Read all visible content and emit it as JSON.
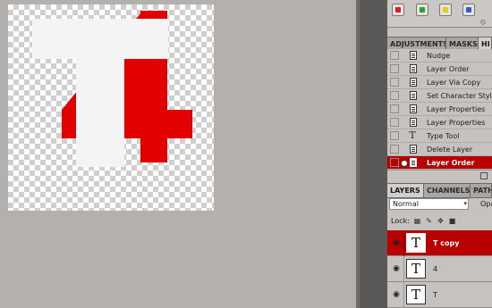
{
  "canvas": {
    "glyph_red": "4",
    "glyph_white": "T",
    "colors": {
      "red": "#e30000",
      "white": "#f4f4f4",
      "checker_light": "#ffffff",
      "checker_dark": "#cfcfcf"
    }
  },
  "swatches": [
    {
      "icon": "red-swatch-icon"
    },
    {
      "icon": "green-swatch-icon"
    },
    {
      "icon": "yellow-swatch-icon"
    },
    {
      "icon": "blue-swatch-icon"
    }
  ],
  "panel_tabs": {
    "top": [
      {
        "label": "ADJUSTMENTS",
        "active": false
      },
      {
        "label": "MASKS",
        "active": false
      },
      {
        "label": "HI",
        "active": true
      }
    ],
    "bottom": [
      {
        "label": "LAYERS",
        "active": true
      },
      {
        "label": "CHANNELS",
        "active": false
      },
      {
        "label": "PATH",
        "active": false
      }
    ]
  },
  "history": {
    "items": [
      {
        "label": "Nudge",
        "icon": "document-icon"
      },
      {
        "label": "Layer Order",
        "icon": "document-icon"
      },
      {
        "label": "Layer Via Copy",
        "icon": "document-icon"
      },
      {
        "label": "Set Character Style",
        "icon": "document-icon"
      },
      {
        "label": "Layer Properties",
        "icon": "document-icon"
      },
      {
        "label": "Layer Properties",
        "icon": "document-icon"
      },
      {
        "label": "Type Tool",
        "icon": "type-tool-icon",
        "glyph": "T"
      },
      {
        "label": "Delete Layer",
        "icon": "document-icon"
      },
      {
        "label": "Layer Order",
        "icon": "document-icon",
        "selected": true
      }
    ]
  },
  "layers": {
    "blend_mode": "Normal",
    "opacity_label": "Opa",
    "lock_label": "Lock:",
    "items": [
      {
        "name": "T copy",
        "thumb": "T",
        "selected": true
      },
      {
        "name": "4",
        "thumb": "T",
        "selected": false
      },
      {
        "name": "T",
        "thumb": "T",
        "selected": false
      }
    ]
  },
  "colors": {
    "selection": "#b80000",
    "panel_bg": "#c5c2bf",
    "workspace_bg": "#b3b0ad"
  }
}
